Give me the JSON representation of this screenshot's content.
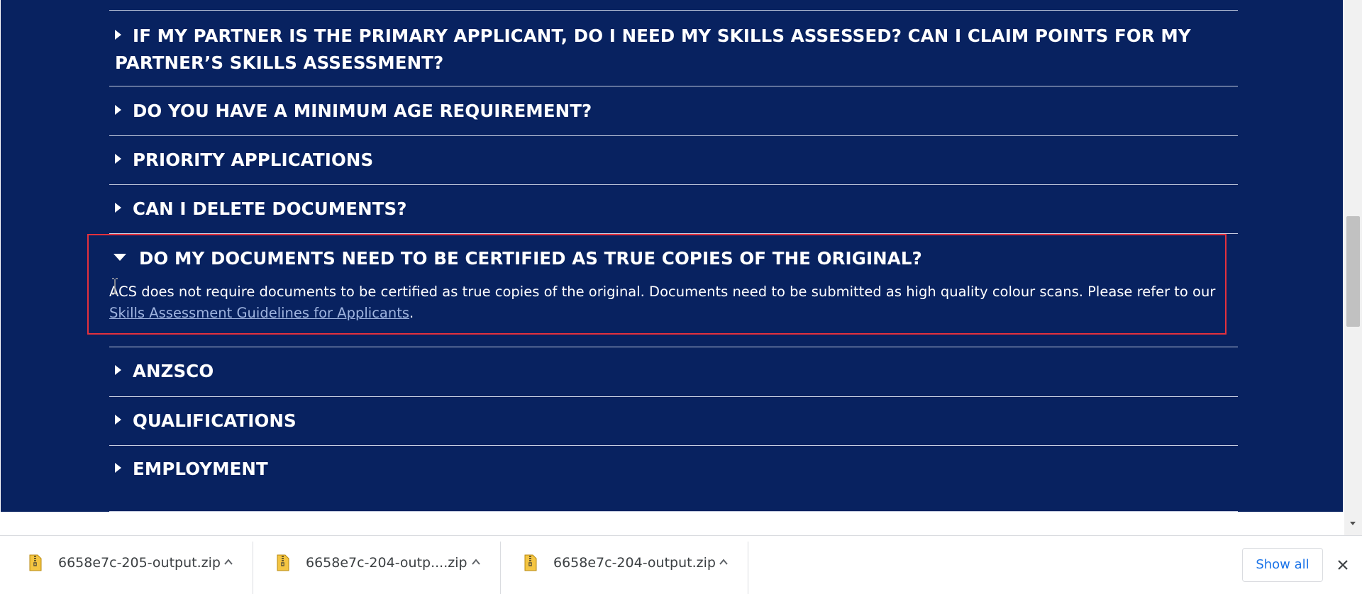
{
  "faq": {
    "items": [
      {
        "title": "IF MY PARTNER IS THE PRIMARY APPLICANT, DO I NEED MY SKILLS ASSESSED? CAN I CLAIM POINTS FOR MY PARTNER’S SKILLS ASSESSMENT?",
        "expanded": false
      },
      {
        "title": "DO YOU HAVE A MINIMUM AGE REQUIREMENT?",
        "expanded": false
      },
      {
        "title": "PRIORITY APPLICATIONS",
        "expanded": false
      },
      {
        "title": "CAN I DELETE DOCUMENTS?",
        "expanded": false
      },
      {
        "title": "DO MY DOCUMENTS NEED TO BE CERTIFIED AS TRUE COPIES OF THE ORIGINAL?",
        "expanded": true
      },
      {
        "title": "ANZSCO",
        "expanded": false
      },
      {
        "title": "QUALIFICATIONS",
        "expanded": false
      },
      {
        "title": "EMPLOYMENT",
        "expanded": false
      }
    ],
    "answer": {
      "text": "ACS does not require documents to be certified as true copies of the original. Documents need to be submitted as high quality colour scans. Please refer to our ",
      "link_text": "Skills Assessment Guidelines for Applicants",
      "suffix": "."
    }
  },
  "downloads": {
    "items": [
      {
        "filename": "6658e7c-205-output.zip",
        "icon": "zip-file-icon"
      },
      {
        "filename": "6658e7c-204-outp....zip",
        "icon": "zip-file-icon"
      },
      {
        "filename": "6658e7c-204-output.zip",
        "icon": "zip-file-icon"
      }
    ],
    "show_all_label": "Show all"
  },
  "colors": {
    "page_background": "#082260",
    "highlight_border": "#e3313d",
    "link": "#9fb4df",
    "show_all_text": "#1a73e8"
  }
}
